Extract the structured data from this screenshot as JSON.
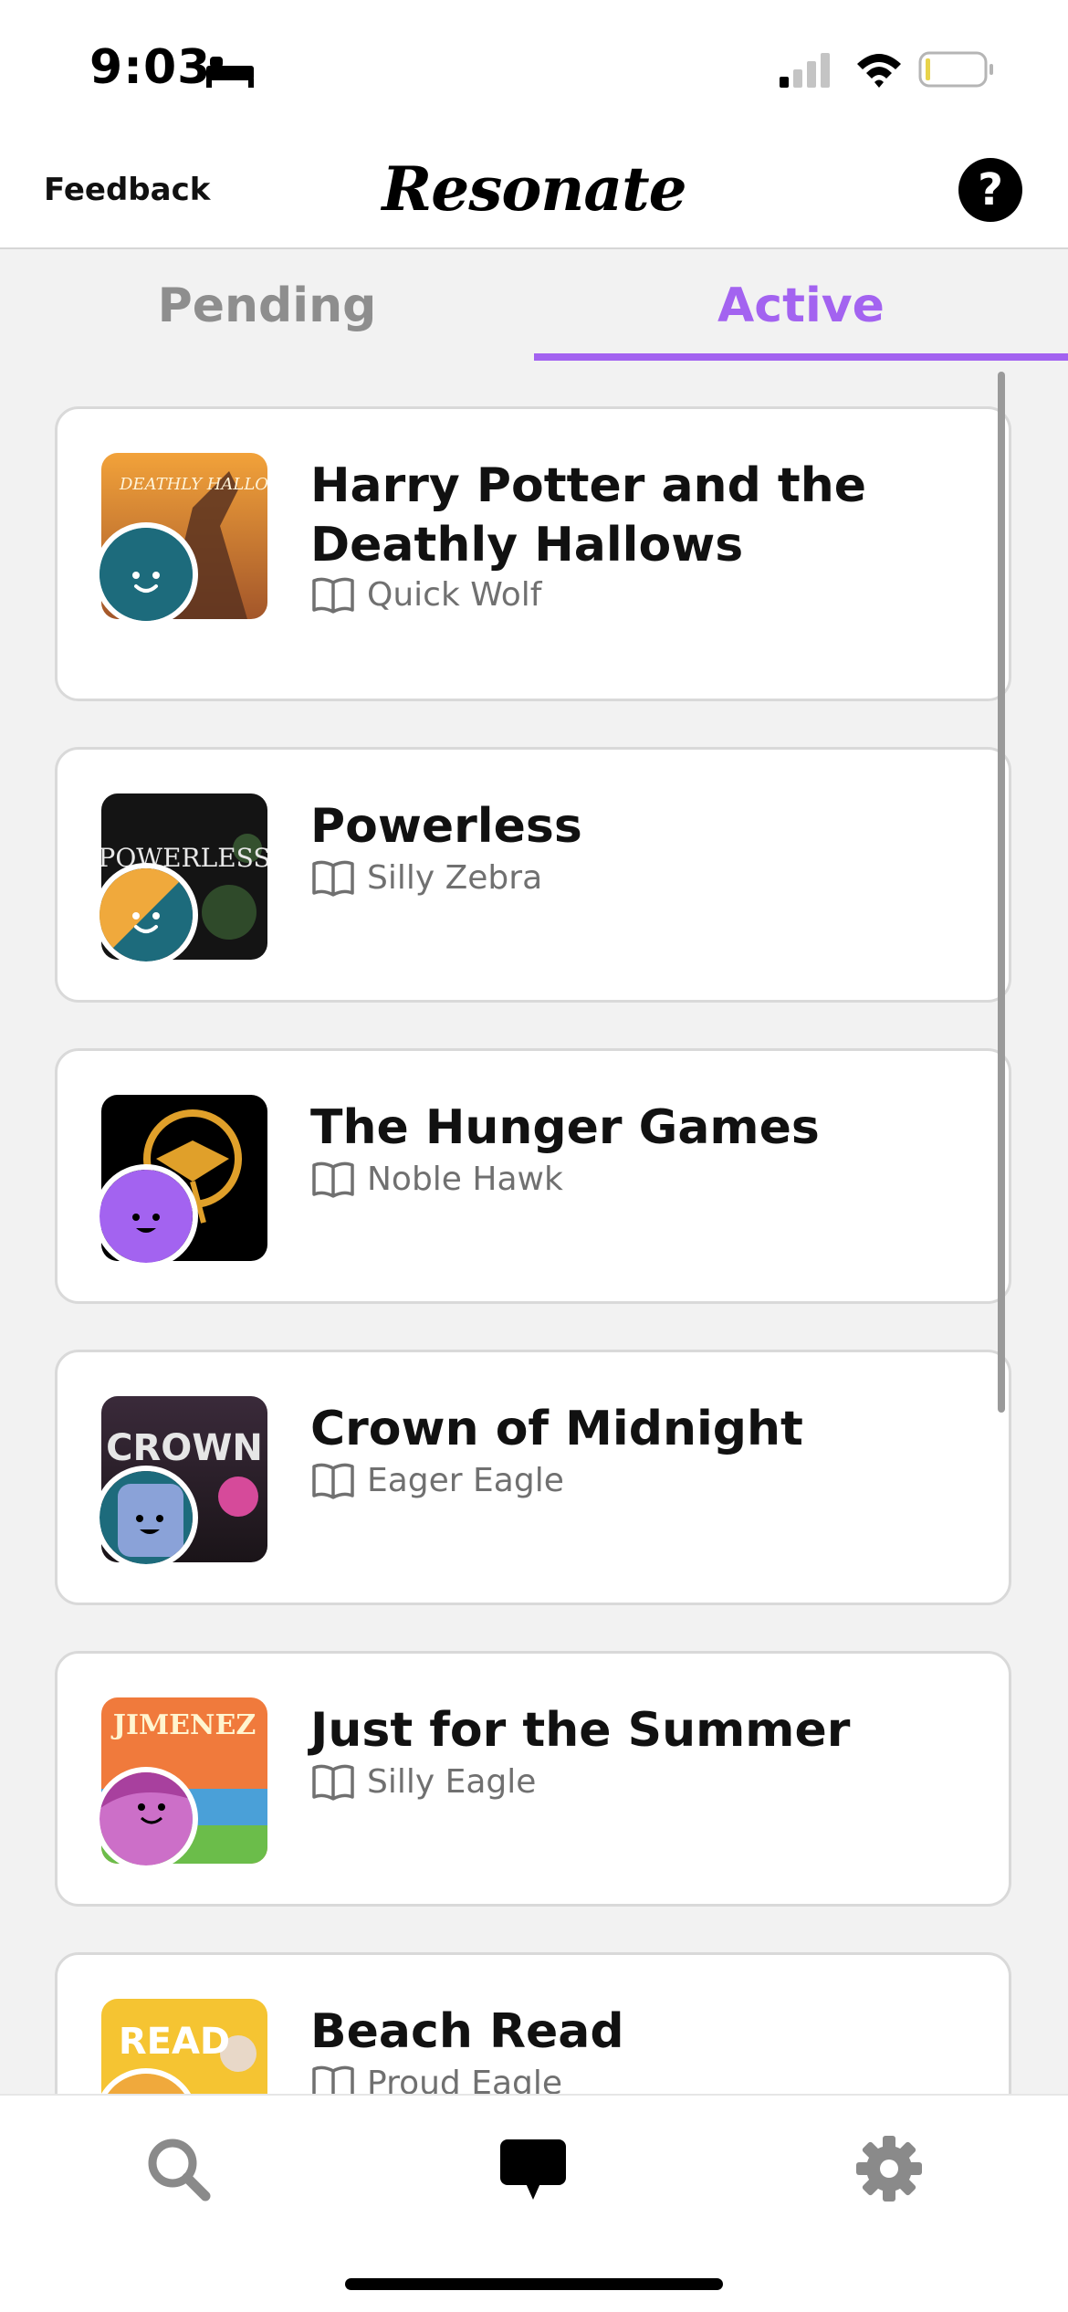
{
  "status_bar": {
    "time": "9:03",
    "icons": [
      "sleep-icon",
      "cellular-signal-icon",
      "wifi-icon",
      "battery-icon"
    ]
  },
  "header": {
    "feedback_label": "Feedback",
    "app_title": "Resonate",
    "help_label": "?"
  },
  "tabs": [
    {
      "label": "Pending",
      "active": false
    },
    {
      "label": "Active",
      "active": true
    }
  ],
  "colors": {
    "accent": "#a363f0",
    "inactive_tab": "#8e8e8e",
    "background": "#f2f2f2"
  },
  "conversations": [
    {
      "title": "Harry Potter and the Deathly Hallows",
      "partner": "Quick Wolf",
      "avatar_color": "#1d6b7c",
      "cover_text": "DEATHLY HALLOWS"
    },
    {
      "title": "Powerless",
      "partner": "Silly Zebra",
      "avatar_color": "#1d6b7c",
      "avatar_color_2": "#f0a93c",
      "cover_text": "POWERLESS"
    },
    {
      "title": "The Hunger Games",
      "partner": "Noble Hawk",
      "avatar_color": "#a363f0",
      "cover_text": ""
    },
    {
      "title": "Crown of Midnight",
      "partner": "Eager Eagle",
      "avatar_color": "#8aa2d8",
      "cover_text": "CROWN"
    },
    {
      "title": "Just for the Summer",
      "partner": "Silly Eagle",
      "avatar_color": "#cc6fc8",
      "cover_text": "JIMENEZ"
    },
    {
      "title": "Beach Read",
      "partner": "Proud Eagle",
      "avatar_color": "#f0a93c",
      "cover_text": "READ"
    }
  ],
  "tab_bar": {
    "icons": [
      "search-icon",
      "chat-icon",
      "settings-icon"
    ]
  }
}
